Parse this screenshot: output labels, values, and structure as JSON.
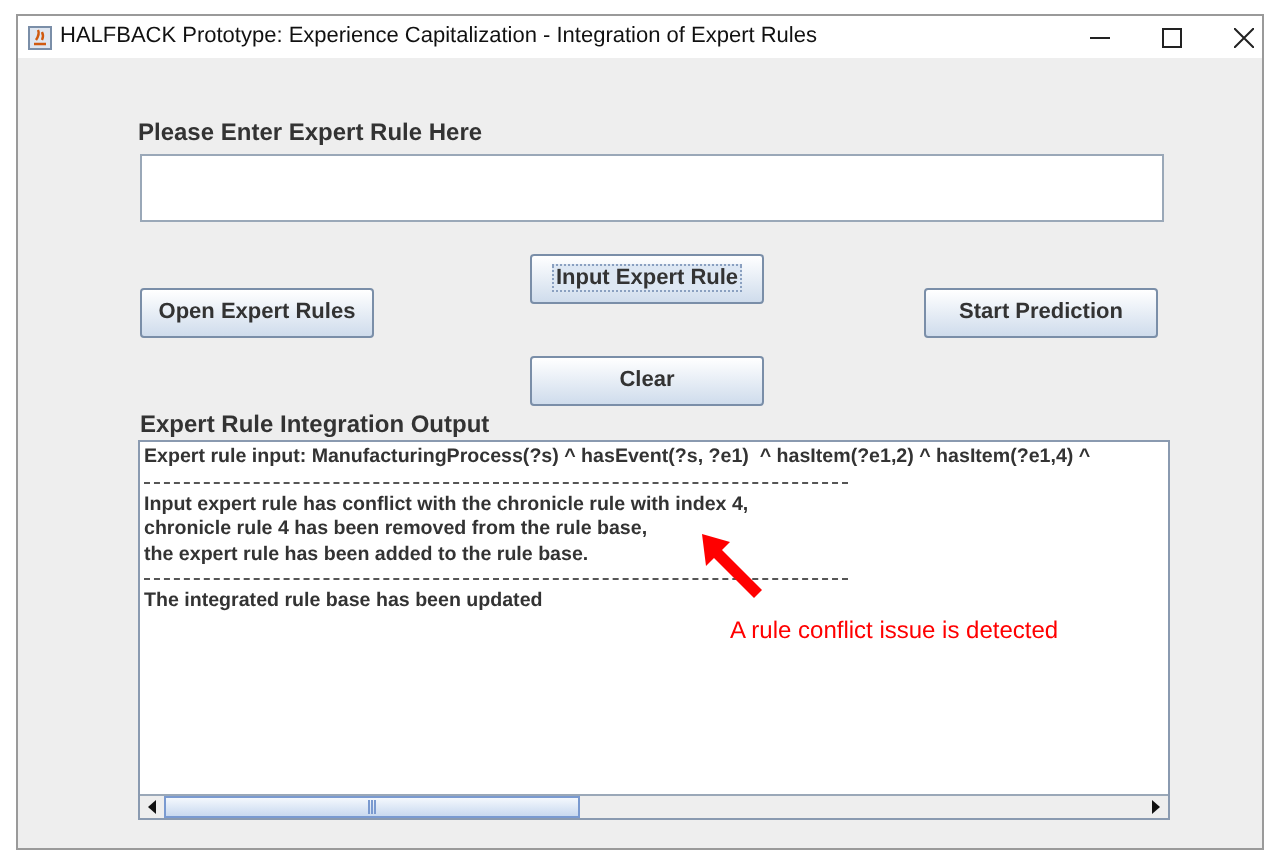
{
  "window": {
    "title": "HALFBACK Prototype: Experience Capitalization - Integration of Expert Rules"
  },
  "rule_field": {
    "label": "Please Enter Expert Rule Here"
  },
  "buttons": [
    {
      "label": "Input Expert Rule",
      "focused": true
    },
    {
      "label": "Open Expert Rules",
      "focused": false
    },
    {
      "label": "Start Prediction",
      "focused": false
    },
    {
      "label": "Clear",
      "focused": false
    }
  ],
  "output": {
    "label": "Expert Rule Integration Output",
    "lines": [
      {
        "kind": "text",
        "text": "Expert rule input: ManufacturingProcess(?s) ^ hasEvent(?s, ?e1)  ^ hasItem(?e1,2) ^ hasItem(?e1,4) ^"
      },
      {
        "kind": "separator"
      },
      {
        "kind": "text",
        "text": "Input expert rule has conflict with the chronicle rule with index 4,"
      },
      {
        "kind": "text",
        "text": "chronicle rule 4 has been removed from the rule base,"
      },
      {
        "kind": "text",
        "text": "the expert rule has been added to the rule base."
      },
      {
        "kind": "separator"
      },
      {
        "kind": "text",
        "text": "The integrated rule base has been updated"
      }
    ]
  },
  "annotation": {
    "text": "A rule conflict issue is detected"
  }
}
